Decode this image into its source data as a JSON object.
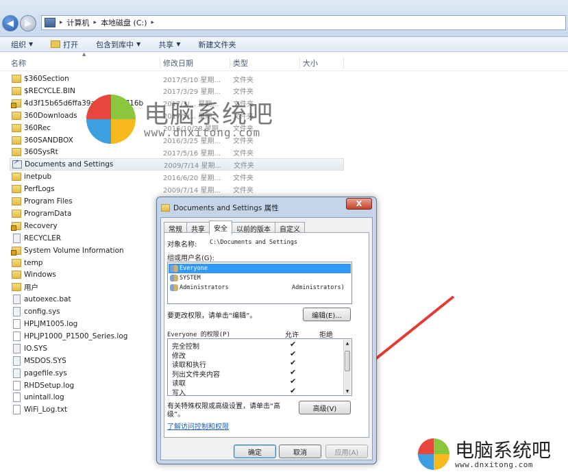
{
  "address_bar": {
    "crumbs": [
      "计算机",
      "本地磁盘 (C:)"
    ]
  },
  "toolbar": {
    "organize": "组织",
    "open": "打开",
    "include_library": "包含到库中",
    "share": "共享",
    "new_folder": "新建文件夹"
  },
  "columns": {
    "name": "名称",
    "modified": "修改日期",
    "type": "类型",
    "size": "大小"
  },
  "files": [
    {
      "name": "$360Section",
      "date": "2017/5/10 星期...",
      "type": "文件夹",
      "icon": "folder"
    },
    {
      "name": "$RECYCLE.BIN",
      "date": "2017/3/29 星期...",
      "type": "文件夹",
      "icon": "folder"
    },
    {
      "name": "4d3f15b65d6ffa39a503e6f8716b",
      "date": "2017/3/... 星期...",
      "type": "文件夹",
      "icon": "folder-lock"
    },
    {
      "name": "360Downloads",
      "date": "2017/5/... 星期...",
      "type": "文件夹",
      "icon": "folder"
    },
    {
      "name": "360Rec",
      "date": "2016/10/28 星期...",
      "type": "文件夹",
      "icon": "folder"
    },
    {
      "name": "360SANDBOX",
      "date": "2016/3/25 星期...",
      "type": "文件夹",
      "icon": "folder"
    },
    {
      "name": "360SysRt",
      "date": "2017/5/16 星期...",
      "type": "文件夹",
      "icon": "folder"
    },
    {
      "name": "Documents and Settings",
      "date": "2009/7/14 星期...",
      "type": "文件夹",
      "icon": "shortcut"
    },
    {
      "name": "inetpub",
      "date": "2016/6/20 星期...",
      "type": "文件夹",
      "icon": "folder"
    },
    {
      "name": "PerfLogs",
      "date": "2009/7/14 星期...",
      "type": "文件夹",
      "icon": "folder"
    },
    {
      "name": "Program Files",
      "date": "",
      "type": "",
      "icon": "folder"
    },
    {
      "name": "ProgramData",
      "date": "",
      "type": "",
      "icon": "folder"
    },
    {
      "name": "Recovery",
      "date": "",
      "type": "",
      "icon": "folder-lock"
    },
    {
      "name": "RECYCLER",
      "date": "",
      "type": "",
      "icon": "sysfile"
    },
    {
      "name": "System Volume Information",
      "date": "",
      "type": "",
      "icon": "folder-lock"
    },
    {
      "name": "temp",
      "date": "",
      "type": "",
      "icon": "folder"
    },
    {
      "name": "Windows",
      "date": "",
      "type": "",
      "icon": "folder"
    },
    {
      "name": "用户",
      "date": "",
      "type": "",
      "icon": "folder"
    },
    {
      "name": "autoexec.bat",
      "date": "",
      "type": "",
      "icon": "sysfile"
    },
    {
      "name": "config.sys",
      "date": "",
      "type": "",
      "icon": "sysfile"
    },
    {
      "name": "HPLJM1005.log",
      "date": "",
      "type": "",
      "icon": "file"
    },
    {
      "name": "HPLJP1000_P1500_Series.log",
      "date": "",
      "type": "",
      "icon": "file"
    },
    {
      "name": "IO.SYS",
      "date": "",
      "type": "",
      "icon": "sysfile"
    },
    {
      "name": "MSDOS.SYS",
      "date": "",
      "type": "",
      "icon": "sysfile"
    },
    {
      "name": "pagefile.sys",
      "date": "",
      "type": "",
      "icon": "sysfile"
    },
    {
      "name": "RHDSetup.log",
      "date": "",
      "type": "",
      "icon": "file"
    },
    {
      "name": "unintall.log",
      "date": "",
      "type": "",
      "icon": "file"
    },
    {
      "name": "WiFi_Log.txt",
      "date": "",
      "type": "",
      "icon": "file"
    }
  ],
  "selected_index": 7,
  "watermark": {
    "title": "电脑系统吧",
    "url": "www.dnxitong.com",
    "colors": [
      "#e8453c",
      "#8cc63f",
      "#3b9fe0",
      "#f7b91b"
    ]
  },
  "dialog": {
    "title": "Documents and Settings 属性",
    "close": "X",
    "tabs": [
      "常规",
      "共享",
      "安全",
      "以前的版本",
      "自定义"
    ],
    "active_tab": 2,
    "object_label": "对象名称:",
    "object_value": "C:\\Documents and Settings",
    "group_label": "组或用户名(G):",
    "users": [
      {
        "name": "Everyone",
        "extra": ""
      },
      {
        "name": "SYSTEM",
        "extra": ""
      },
      {
        "name": "Administrators",
        "extra": "Administrators)"
      }
    ],
    "edit_hint": "要更改权限，请单击“编辑”。",
    "edit_button": "编辑(E)...",
    "perm_label": "Everyone 的权限(P)",
    "allow_label": "允许",
    "deny_label": "拒绝",
    "permissions": [
      {
        "name": "完全控制",
        "allow": "✔"
      },
      {
        "name": "修改",
        "allow": "✔"
      },
      {
        "name": "读取和执行",
        "allow": "✔"
      },
      {
        "name": "列出文件夹内容",
        "allow": "✔"
      },
      {
        "name": "读取",
        "allow": "✔"
      },
      {
        "name": "写入",
        "allow": "✔"
      }
    ],
    "advanced_hint_line1": "有关特殊权限或高级设置，请单击“高",
    "advanced_hint_line2": "级”。",
    "advanced_button": "高级(V)",
    "link": "了解访问控制和权限",
    "ok": "确定",
    "cancel": "取消",
    "apply": "应用(A)"
  }
}
